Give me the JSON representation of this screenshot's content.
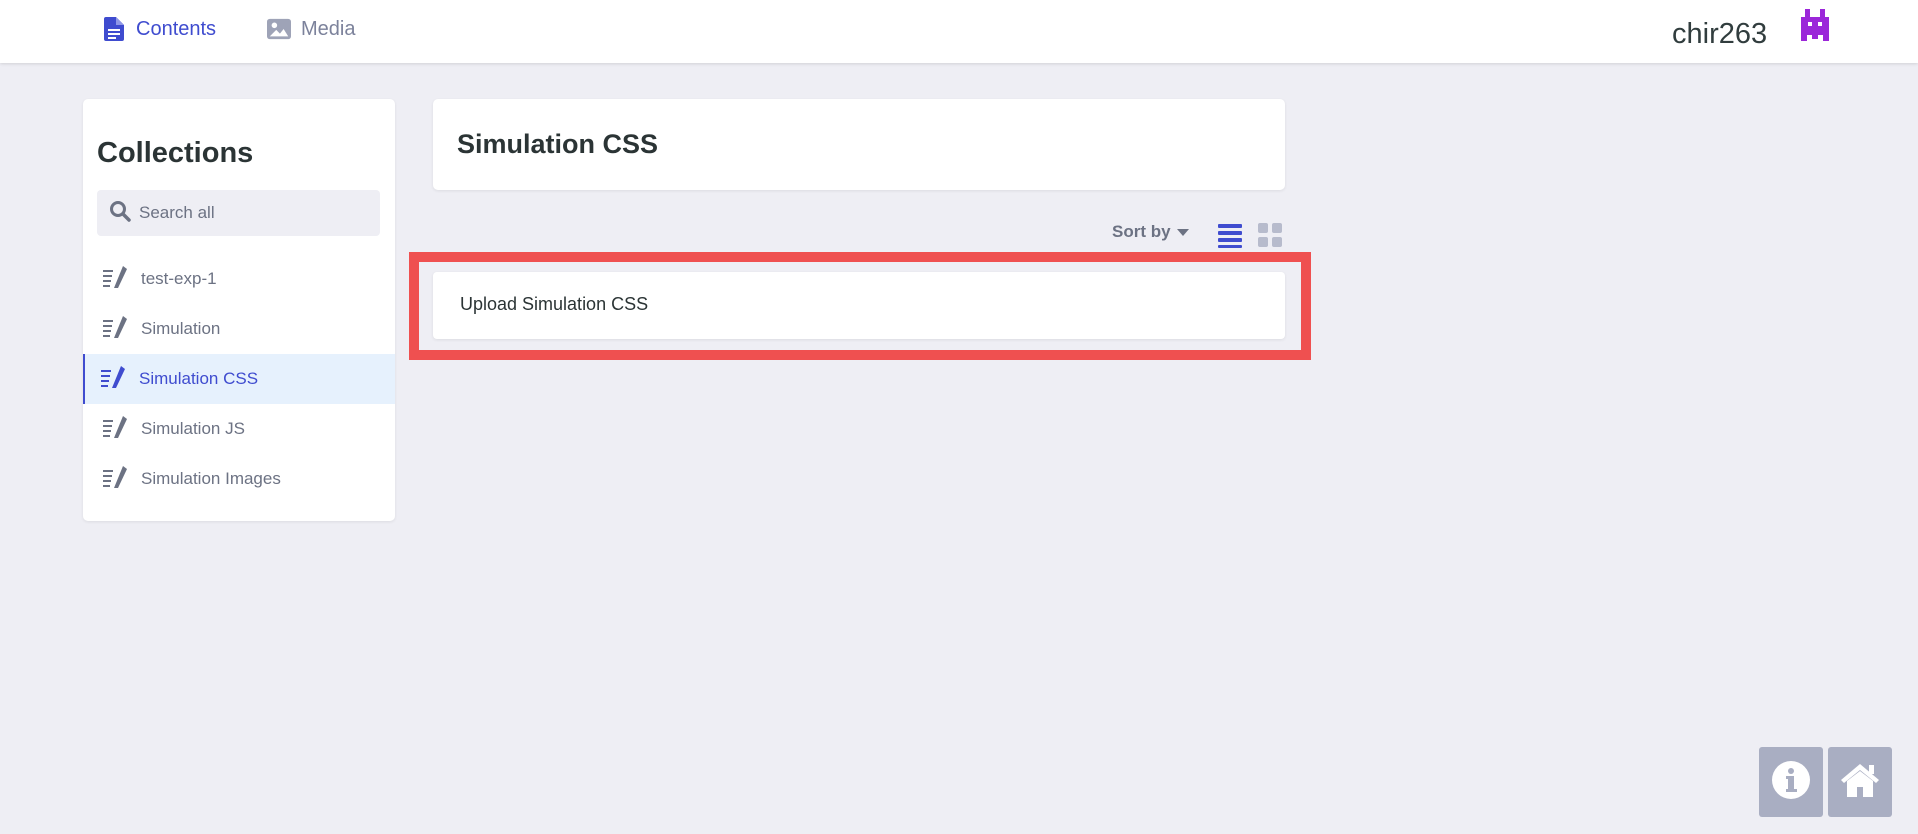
{
  "nav": {
    "tabs": [
      {
        "label": "Contents",
        "icon": "document-icon",
        "active": true
      },
      {
        "label": "Media",
        "icon": "image-icon",
        "active": false
      }
    ],
    "username": "chir263",
    "colors": {
      "accent": "#3f4ccf",
      "avatar": "#9b27d9"
    }
  },
  "sidebar": {
    "title": "Collections",
    "search_placeholder": "Search all",
    "items": [
      {
        "label": "test-exp-1",
        "icon": "collection-edit-icon",
        "active": false
      },
      {
        "label": "Simulation",
        "icon": "collection-edit-icon",
        "active": false
      },
      {
        "label": "Simulation CSS",
        "icon": "collection-edit-icon",
        "active": true
      },
      {
        "label": "Simulation JS",
        "icon": "collection-edit-icon",
        "active": false
      },
      {
        "label": "Simulation Images",
        "icon": "collection-edit-icon",
        "active": false
      }
    ]
  },
  "main": {
    "title": "Simulation CSS",
    "sort_label": "Sort by",
    "entries": [
      {
        "label": "Upload Simulation CSS",
        "highlighted": true
      }
    ],
    "highlight_color": "#ef5050"
  },
  "corner": {
    "info_icon": "info-icon",
    "home_icon": "home-icon"
  }
}
